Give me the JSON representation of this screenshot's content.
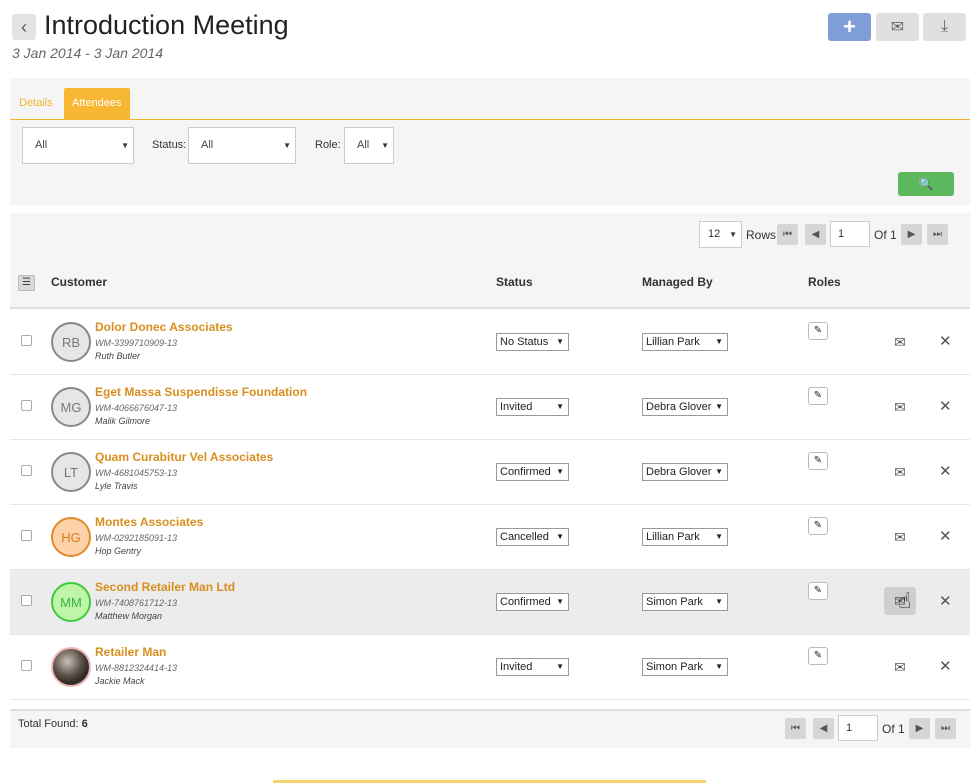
{
  "header": {
    "title": "Introduction Meeting",
    "date_range": "3 Jan 2014 - 3 Jan 2014",
    "back_icon": "‹",
    "add_icon": "+",
    "mail_icon": "✉",
    "download_icon": "⤓"
  },
  "tabs": [
    {
      "label": "Details",
      "active": false
    },
    {
      "label": "Attendees",
      "active": true
    }
  ],
  "filters": {
    "type_value": "All",
    "status_label": "Status:",
    "status_value": "All",
    "role_label": "Role:",
    "role_value": "All",
    "search_icon": "🔍"
  },
  "pagination": {
    "rows_per_page": "12",
    "rows_label": "Rows",
    "page": "1",
    "of_label": "Of 1"
  },
  "table": {
    "headers": {
      "customer": "Customer",
      "status": "Status",
      "managed_by": "Managed By",
      "roles": "Roles"
    },
    "rows": [
      {
        "initials": "RB",
        "name": "Dolor Donec Associates",
        "code": "WM-3399710909-13",
        "person": "Ruth Butler",
        "status": "No Status",
        "manager": "Lillian Park"
      },
      {
        "initials": "MG",
        "name": "Eget Massa Suspendisse Foundation",
        "code": "WM-4066676047-13",
        "person": "Malik Gilmore",
        "status": "Invited",
        "manager": "Debra Glover"
      },
      {
        "initials": "LT",
        "name": "Quam Curabitur Vel Associates",
        "code": "WM-4681045753-13",
        "person": "Lyle Travis",
        "status": "Confirmed",
        "manager": "Debra Glover"
      },
      {
        "initials": "HG",
        "name": "Montes Associates",
        "code": "WM-0292185091-13",
        "person": "Hop Gentry",
        "status": "Cancelled",
        "manager": "Lillian Park"
      },
      {
        "initials": "MM",
        "name": "Second Retailer Man Ltd",
        "code": "WM-7408761712-13",
        "person": "Matthew Morgan",
        "status": "Confirmed",
        "manager": "Simon Park"
      },
      {
        "initials": "",
        "name": "Retailer Man",
        "code": "WM-8812324414-13",
        "person": "Jackie Mack",
        "status": "Invited",
        "manager": "Simon Park"
      }
    ]
  },
  "footer": {
    "total_label": "Total Found:",
    "total_value": "6",
    "page": "1",
    "of_label": "Of 1"
  },
  "icons": {
    "edit": "✎",
    "mail": "✉",
    "delete": "✕",
    "caret": "▼",
    "menu": "☰",
    "first": "⏮",
    "prev": "◀",
    "next": "▶",
    "last": "⏭",
    "cursor": "☝"
  }
}
